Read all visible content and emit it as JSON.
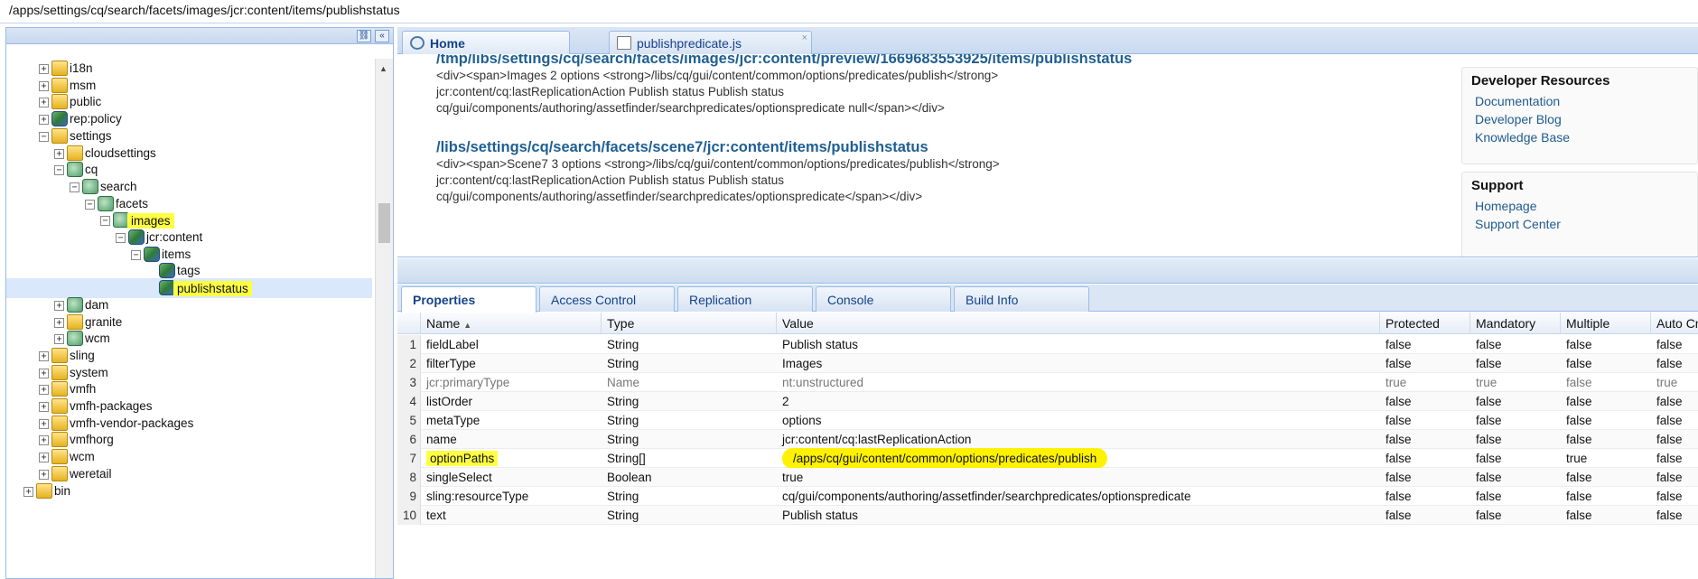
{
  "path_bar": "/apps/settings/cq/search/facets/images/jcr:content/items/publishstatus",
  "tree": {
    "items": [
      {
        "label": "i18n",
        "icon": "folder-icon"
      },
      {
        "label": "msm",
        "icon": "folder-icon"
      },
      {
        "label": "public",
        "icon": "folder-icon"
      },
      {
        "label": "rep:policy",
        "icon": "policy-node-icon"
      },
      {
        "label": "settings",
        "icon": "folder-icon"
      },
      {
        "label": "cloudsettings",
        "icon": "folder-icon"
      },
      {
        "label": "cq",
        "icon": "node-icon"
      },
      {
        "label": "search",
        "icon": "node-icon"
      },
      {
        "label": "facets",
        "icon": "node-icon"
      },
      {
        "label": "images",
        "icon": "node-icon"
      },
      {
        "label": "jcr:content",
        "icon": "component-node-icon"
      },
      {
        "label": "items",
        "icon": "component-node-icon"
      },
      {
        "label": "tags",
        "icon": "component-node-icon"
      },
      {
        "label": "publishstatus",
        "icon": "component-node-icon"
      },
      {
        "label": "dam",
        "icon": "node-icon"
      },
      {
        "label": "granite",
        "icon": "folder-icon"
      },
      {
        "label": "wcm",
        "icon": "node-icon"
      },
      {
        "label": "sling",
        "icon": "folder-icon"
      },
      {
        "label": "system",
        "icon": "folder-icon"
      },
      {
        "label": "vmfh",
        "icon": "folder-icon"
      },
      {
        "label": "vmfh-packages",
        "icon": "folder-icon"
      },
      {
        "label": "vmfh-vendor-packages",
        "icon": "folder-icon"
      },
      {
        "label": "vmfhorg",
        "icon": "folder-icon"
      },
      {
        "label": "wcm",
        "icon": "folder-icon"
      },
      {
        "label": "weretail",
        "icon": "folder-icon"
      },
      {
        "label": "bin",
        "icon": "folder-icon"
      }
    ]
  },
  "tabs": [
    {
      "label": "Home",
      "icon": "home-icon"
    },
    {
      "label": "publishpredicate.js",
      "icon": "file-icon",
      "close": "×"
    }
  ],
  "home": {
    "results": [
      {
        "title": "/tmp/libs/settings/cq/search/facets/images/jcr:content/preview/1669683553925/items/publishstatus",
        "lines": [
          "<div><span>Images 2 options <strong>/libs/cq/gui/content/common/options/predicates/publish</strong>",
          "jcr:content/cq:lastReplicationAction Publish status Publish status",
          "cq/gui/components/authoring/assetfinder/searchpredicates/optionspredicate null</span></div>"
        ]
      },
      {
        "title": "/libs/settings/cq/search/facets/scene7/jcr:content/items/publishstatus",
        "lines": [
          "<div><span>Scene7 3 options <strong>/libs/cq/gui/content/common/options/predicates/publish</strong>",
          "jcr:content/cq:lastReplicationAction Publish status Publish status",
          "cq/gui/components/authoring/assetfinder/searchpredicates/optionspredicate</span></div>"
        ]
      }
    ],
    "developer_resources": {
      "heading": "Developer Resources",
      "links": [
        "Documentation",
        "Developer Blog",
        "Knowledge Base"
      ]
    },
    "support": {
      "heading": "Support",
      "links": [
        "Homepage",
        "Support Center"
      ]
    }
  },
  "property_tabs": [
    "Properties",
    "Access Control",
    "Replication",
    "Console",
    "Build Info"
  ],
  "grid": {
    "columns": [
      "Name",
      "Type",
      "Value",
      "Protected",
      "Mandatory",
      "Multiple",
      "Auto Created"
    ],
    "rows": [
      {
        "n": "1",
        "name": "fieldLabel",
        "type": "String",
        "value": "Publish status",
        "protected": "false",
        "mandatory": "false",
        "multiple": "false",
        "auto": "false"
      },
      {
        "n": "2",
        "name": "filterType",
        "type": "String",
        "value": "Images",
        "protected": "false",
        "mandatory": "false",
        "multiple": "false",
        "auto": "false"
      },
      {
        "n": "3",
        "name": "jcr:primaryType",
        "type": "Name",
        "value": "nt:unstructured",
        "protected": "true",
        "mandatory": "true",
        "multiple": "false",
        "auto": "true"
      },
      {
        "n": "4",
        "name": "listOrder",
        "type": "String",
        "value": "2",
        "protected": "false",
        "mandatory": "false",
        "multiple": "false",
        "auto": "false"
      },
      {
        "n": "5",
        "name": "metaType",
        "type": "String",
        "value": "options",
        "protected": "false",
        "mandatory": "false",
        "multiple": "false",
        "auto": "false"
      },
      {
        "n": "6",
        "name": "name",
        "type": "String",
        "value": "jcr:content/cq:lastReplicationAction",
        "protected": "false",
        "mandatory": "false",
        "multiple": "false",
        "auto": "false"
      },
      {
        "n": "7",
        "name": "optionPaths",
        "type": "String[]",
        "value": "/apps/cq/gui/content/common/options/predicates/publish",
        "protected": "false",
        "mandatory": "false",
        "multiple": "true",
        "auto": "false"
      },
      {
        "n": "8",
        "name": "singleSelect",
        "type": "Boolean",
        "value": "true",
        "protected": "false",
        "mandatory": "false",
        "multiple": "false",
        "auto": "false"
      },
      {
        "n": "9",
        "name": "sling:resourceType",
        "type": "String",
        "value": "cq/gui/components/authoring/assetfinder/searchpredicates/optionspredicate",
        "protected": "false",
        "mandatory": "false",
        "multiple": "false",
        "auto": "false"
      },
      {
        "n": "10",
        "name": "text",
        "type": "String",
        "value": "Publish status",
        "protected": "false",
        "mandatory": "false",
        "multiple": "false",
        "auto": "false"
      }
    ]
  },
  "colors": {
    "highlight": "#ffff44",
    "link": "#1e5f93",
    "panel_border": "#99bbe8",
    "tab_text": "#15428b"
  }
}
